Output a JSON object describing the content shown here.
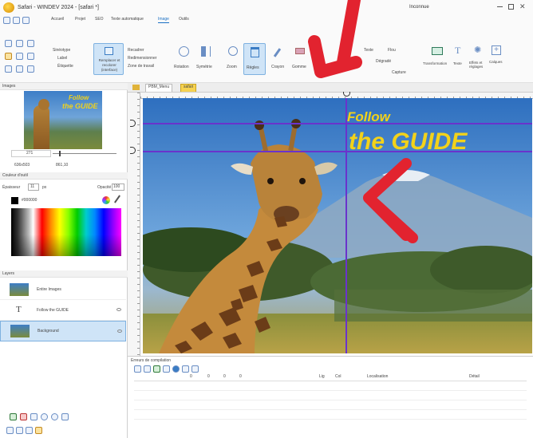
{
  "app": {
    "title": "Safari - WINDEV 2024 - [safari *]",
    "top_right_label": "Inconnue",
    "tabs": [
      "Accueil",
      "Projet",
      "SEO",
      "Texte automatique",
      "Image",
      "Outils"
    ],
    "active_tab": "Image"
  },
  "ribbon": {
    "group1": {
      "items": [
        "Sinéotype",
        "Label",
        "Étiquette"
      ]
    },
    "big_button": "Remplacer et recolorer (interface)",
    "group2": {
      "items": [
        "Recadrer",
        "Redimensionner",
        "Zone de travail"
      ]
    },
    "group3": {
      "items": [
        "Rotation",
        "Symétrie"
      ]
    },
    "group4": {
      "items": [
        "Zoom",
        "Règles"
      ]
    },
    "crayon": "Crayon",
    "gomme": "Gomme",
    "group5": {
      "items": [
        "Texte",
        "Flou",
        "Dégradé",
        "Capture"
      ]
    },
    "group5_label": "Image",
    "transform": "Transformation",
    "texts": "Texte",
    "effects": "Effets et réglages",
    "calques": "Calques"
  },
  "left": {
    "images_header": "Images",
    "thumb_follow": "Follow",
    "thumb_guide": "the GUIDE",
    "zoom_value": "271",
    "size_label": "636x503",
    "pos_label": "861,10",
    "color_header": "Couleur d'outil",
    "epaisseur_label": "Épaisseur",
    "epaisseur_value": "11",
    "unit": "px",
    "opacity_label": "Opacité",
    "opacity_value": "100",
    "hex_value": "#000000",
    "layers_header": "Layers",
    "layers": [
      {
        "name": "Entire Images",
        "icon": "image-icon"
      },
      {
        "name": "Follow the GUIDE",
        "icon": "text-icon"
      },
      {
        "name": "Background",
        "icon": "image-icon"
      }
    ]
  },
  "editor": {
    "tabs": [
      "PBM_Menu",
      "safari"
    ],
    "active_tab": "safari",
    "overlay_follow": "Follow",
    "overlay_guide": "the GUIDE"
  },
  "bottom": {
    "header": "Erreurs de compilation",
    "filters": [
      "0",
      "0",
      "0",
      "0"
    ],
    "columns": [
      "Lig",
      "Col",
      "Localisation",
      "Détail"
    ]
  },
  "colors": {
    "accent": "#e2232f",
    "guide": "#6a33cc",
    "overlay_text": "#f2d21a"
  }
}
